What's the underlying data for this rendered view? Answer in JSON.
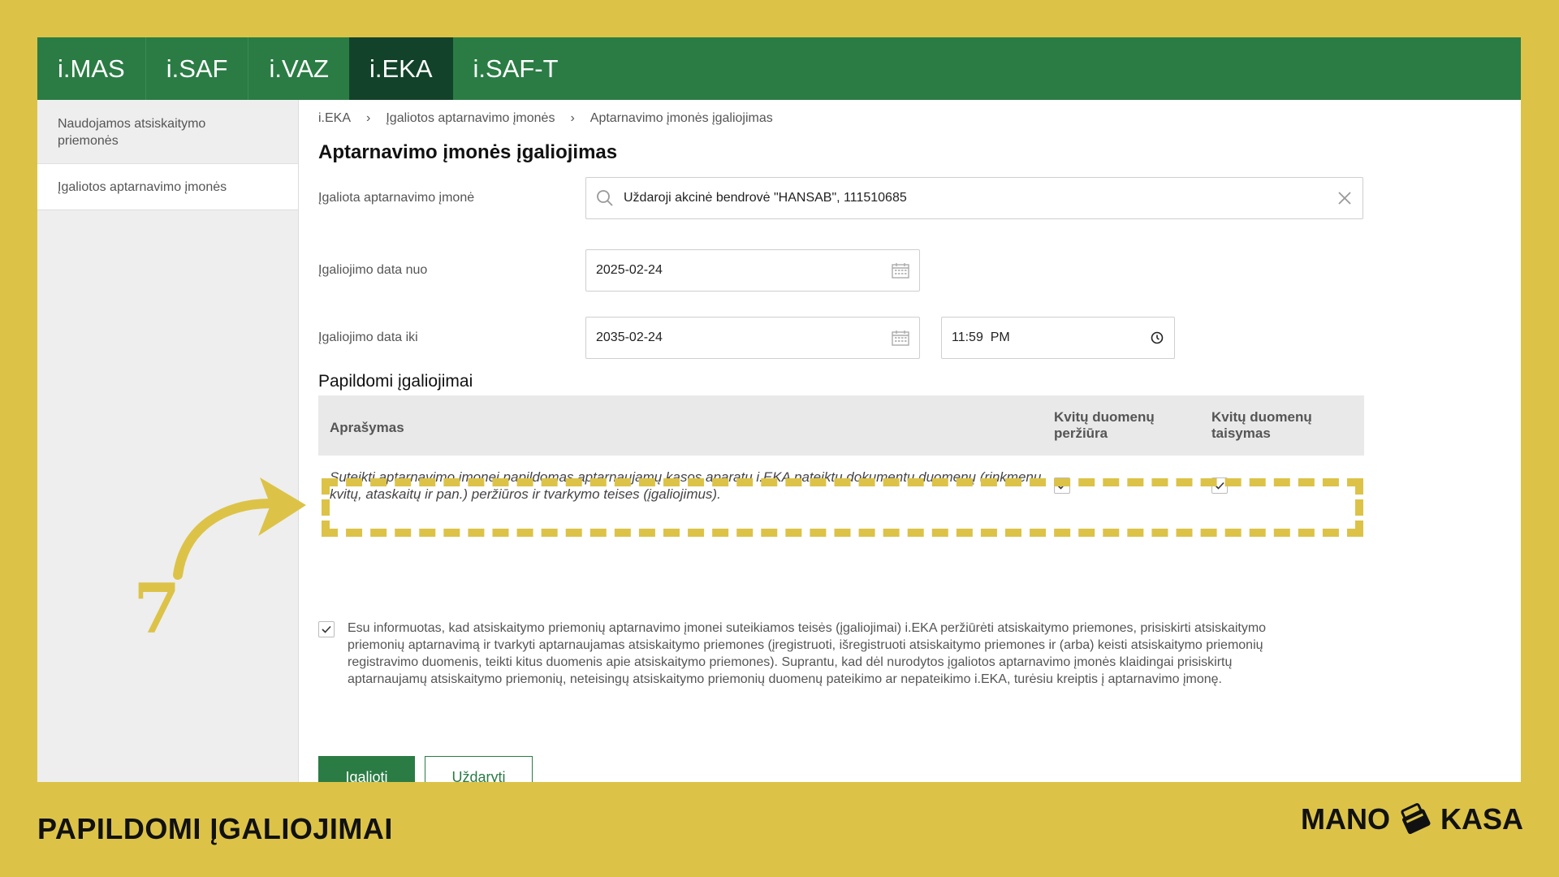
{
  "nav": {
    "tabs": [
      {
        "label": "i.MAS"
      },
      {
        "label": "i.SAF"
      },
      {
        "label": "i.VAZ"
      },
      {
        "label": "i.EKA",
        "active": true
      },
      {
        "label": "i.SAF-T"
      }
    ],
    "active_color": "#12432a",
    "bar_color": "#2a7c44"
  },
  "sidebar": {
    "items": [
      {
        "label": "Naudojamos atsiskaitymo priemonės"
      },
      {
        "label": "Įgaliotos aptarnavimo įmonės",
        "active": true
      }
    ]
  },
  "breadcrumb": {
    "items": [
      "i.EKA",
      "Įgaliotos aptarnavimo įmonės",
      "Aptarnavimo įmonės įgaliojimas"
    ],
    "separator": "›"
  },
  "page": {
    "title": "Aptarnavimo įmonės įgaliojimas"
  },
  "form": {
    "company_label": "Įgaliota aptarnavimo įmonė",
    "company_value": "Uždaroji akcinė bendrovė \"HANSAB\", 111510685",
    "date_from_label": "Įgaliojimo data nuo",
    "date_from_value": "2025-02-24",
    "date_to_label": "Įgaliojimo data iki",
    "date_to_value": "2035-02-24",
    "time_to_value": "11:59  PM"
  },
  "permissions": {
    "title": "Papildomi įgaliojimai",
    "columns": {
      "description": "Aprašymas",
      "view": "Kvitų duomenų peržiūra",
      "edit": "Kvitų duomenų taisymas"
    },
    "rows": [
      {
        "description": "Suteikti aptarnavimo įmonei papildomas aptarnaujamų kasos aparatų i.EKA pateiktų dokumentų duomenų (rinkmenų, kvitų, ataskaitų ir pan.) peržiūros ir tvarkymo teises (įgaliojimus).",
        "view": true,
        "edit": true
      }
    ]
  },
  "consent": {
    "checked": true,
    "text": "Esu informuotas, kad atsiskaitymo priemonių aptarnavimo įmonei suteikiamos teisės (įgaliojimai) i.EKA peržiūrėti atsiskaitymo priemones, prisiskirti atsiskaitymo priemonių aptarnavimą ir tvarkyti aptarnaujamas atsiskaitymo priemones (įregistruoti, išregistruoti atsiskaitymo priemones ir (arba) keisti atsiskaitymo priemonių registravimo duomenis, teikti kitus duomenis apie atsiskaitymo priemones). Suprantu, kad dėl nurodytos įgaliotos aptarnavimo įmonės klaidingai prisiskirtų aptarnaujamų atsiskaitymo priemonių, neteisingų atsiskaitymo priemonių duomenų pateikimo ar nepateikimo i.EKA, turėsiu kreiptis į aptarnavimo įmonę."
  },
  "buttons": {
    "submit": "Įgalioti",
    "close": "Uždaryti"
  },
  "annotation": {
    "step_number": "7",
    "highlight_color": "#dcc348"
  },
  "footer": {
    "title": "PAPILDOMI ĮGALIOJIMAI",
    "brand_left": "MANO",
    "brand_right": "KASA"
  }
}
